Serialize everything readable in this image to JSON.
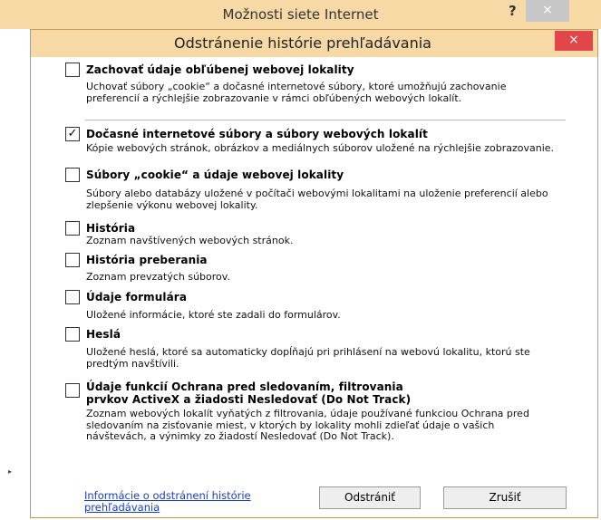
{
  "outer_window": {
    "title": "Možnosti siete Internet",
    "help": "?",
    "close": "×"
  },
  "dialog": {
    "title": "Odstránenie histórie prehľadávania",
    "close": "×"
  },
  "options": [
    {
      "checked": false,
      "title": "Zachovať údaje obľúbenej webovej lokality",
      "desc": "Uchovať súbory „cookie“ a dočasné internetové súbory, ktoré umožňujú zachovanie preferencií a rýchlejšie zobrazovanie v rámci obľúbených webových lokalít."
    },
    {
      "checked": true,
      "title": "Dočasné internetové súbory a súbory webových lokalít",
      "desc": "Kópie webových stránok, obrázkov a mediálnych súborov uložené na rýchlejšie zobrazovanie."
    },
    {
      "checked": false,
      "title": "Súbory „cookie“ a údaje webovej lokality",
      "desc": "Súbory alebo databázy uložené v počítači webovými lokalitami na uloženie preferencií alebo zlepšenie výkonu webovej lokality."
    },
    {
      "checked": false,
      "title": "História",
      "desc": "Zoznam navštívených webových stránok."
    },
    {
      "checked": false,
      "title": "História preberania",
      "desc": "Zoznam prevzatých súborov."
    },
    {
      "checked": false,
      "title": "Údaje formulára",
      "desc": "Uložené informácie, ktoré ste zadali do formulárov."
    },
    {
      "checked": false,
      "title": "Heslá",
      "desc": "Uložené heslá, ktoré sa automaticky dopĺňajú pri prihlásení na webovú lokalitu, ktorú ste predtým navštívili."
    },
    {
      "checked": false,
      "title": "Údaje funkcií Ochrana pred sledovaním, filtrovania prvkov ActiveX a žiadosti Nesledovať (Do Not Track)",
      "desc": "Zoznam webových lokalít vyňatých z filtrovania, údaje používané funkciou Ochrana pred sledovaním na zisťovanie miest, v ktorých by lokality mohli zdieľať údaje o vašich návštevách, a výnimky zo žiadostí Nesledovať (Do Not Track)."
    }
  ],
  "footer": {
    "help_link": "Informácie o odstránení histórie prehľadávania",
    "delete_label": "Odstrániť",
    "cancel_label": "Zrušiť"
  },
  "check_glyph": "✓",
  "side_mark": "▸",
  "colors": {
    "titlebar": "#f7d9a6",
    "close_red": "#e0464a",
    "link": "#1a3fb8"
  }
}
